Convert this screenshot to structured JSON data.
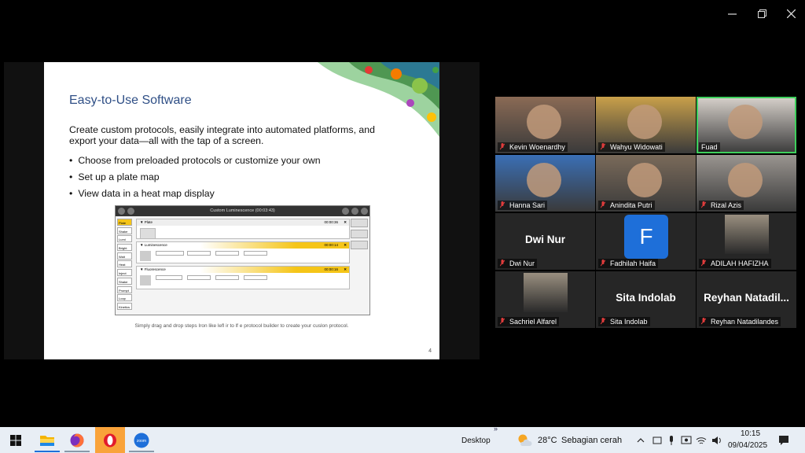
{
  "slide": {
    "title": "Easy-to-Use Software",
    "intro": "Create custom protocols, easily integrate into automated platforms, and export your data—all with the tap of a screen.",
    "bullets": [
      "Choose from preloaded protocols or customize your own",
      "Set up a plate map",
      "View data in a heat map display"
    ],
    "caption": "Simply drag and drop steps Iron  like lefl ir  to lf e protocol builder to create your cuslon  protocol.",
    "page_number": "4",
    "app_window": {
      "title": "Custom Luminescence (00:03:43)",
      "steps": [
        "Plate",
        "Shake",
        "Lumi",
        "Bright",
        "Wait",
        "Heat",
        "Inject",
        "Shake",
        "Prompt",
        "Loop",
        "Kinetics"
      ],
      "sections": [
        {
          "name": "Plate",
          "time": "00:00:36"
        },
        {
          "name": "Luminescence",
          "time": "00:00:14"
        },
        {
          "name": "Fluorescence",
          "time": "00:00:16"
        }
      ]
    }
  },
  "participants": [
    {
      "name": "Kevin Woenardhy",
      "type": "video",
      "muted": true,
      "active": false
    },
    {
      "name": "Wahyu Widowati",
      "type": "video",
      "muted": true,
      "active": false
    },
    {
      "name": "Fuad",
      "type": "video",
      "muted": false,
      "active": true
    },
    {
      "name": "Hanna Sari",
      "type": "video",
      "muted": true,
      "active": false
    },
    {
      "name": "Anindita Putri",
      "type": "video",
      "muted": true,
      "active": false
    },
    {
      "name": "Rizal Azis",
      "type": "video",
      "muted": true,
      "active": false
    },
    {
      "name": "Dwi Nur",
      "type": "name",
      "display": "Dwi Nur",
      "muted": true,
      "active": false
    },
    {
      "name": "Fadhilah Haifa",
      "type": "avatar-letter",
      "display": "F",
      "muted": true,
      "active": false
    },
    {
      "name": "ADILAH HAFIZHA",
      "type": "photo",
      "muted": true,
      "active": false
    },
    {
      "name": "Sachriel Alfarel",
      "type": "photo",
      "muted": true,
      "active": false
    },
    {
      "name": "Sita Indolab",
      "type": "name",
      "display": "Sita Indolab",
      "muted": true,
      "active": false
    },
    {
      "name": "Reyhan Natadilandes",
      "type": "name",
      "display": "Reyhan  Natadil...",
      "muted": true,
      "active": false
    }
  ],
  "taskbar": {
    "desktop_label": "Desktop",
    "weather_temp": "28°C",
    "weather_text": "Sebagian cerah",
    "time": "10:15",
    "date": "09/04/2025",
    "apps": [
      "start-icon",
      "file-explorer-icon",
      "firefox-icon",
      "opera-icon",
      "zoom-icon"
    ]
  },
  "colors": {
    "accent_green": "#3ecf5c",
    "slide_title": "#2f4f86",
    "muted_red": "#e03c3c",
    "zoom_blue": "#1e6fd9"
  }
}
